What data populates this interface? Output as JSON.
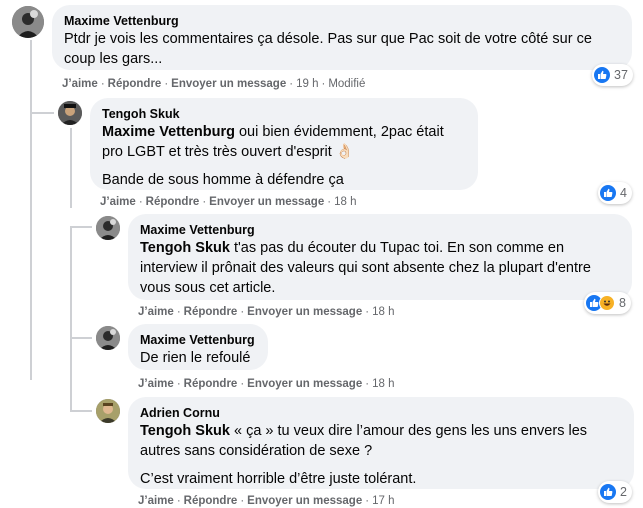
{
  "colors": {
    "bubble": "#f0f2f5",
    "like_blue": "#1877f2",
    "meta_gray": "#65676b",
    "thread_line": "#ced0d4"
  },
  "actions": {
    "like": "J’aime",
    "reply": "Répondre",
    "message": "Envoyer un message",
    "dot": "·"
  },
  "comments": [
    {
      "author": "Maxime Vettenburg",
      "avatar_icon": "user-avatar-icon",
      "text": "Ptdr je vois les commentaires ça désole. Pas sur que Pac soit de votre côté sur ce coup les gars...",
      "time": "19 h",
      "edited": "Modifié",
      "reactions": {
        "icons": [
          "like-icon"
        ],
        "count": "37"
      }
    },
    {
      "author": "Tengoh Skuk",
      "avatar_icon": "user-avatar-icon",
      "mention": "Maxime Vettenburg",
      "text": " oui bien évidemment, 2pac était pro LGBT et très très ouvert d'esprit 👌🏻",
      "text2": "Bande de sous homme à défendre ça",
      "time": "18 h",
      "reactions": {
        "icons": [
          "like-icon"
        ],
        "count": "4"
      }
    },
    {
      "author": "Maxime Vettenburg",
      "avatar_icon": "user-avatar-icon",
      "mention": "Tengoh Skuk",
      "text": " t'as pas du écouter du Tupac toi. En son comme en interview il prônait des valeurs qui sont absente chez la plupart d'entre vous sous cet article.",
      "time": "18 h",
      "reactions": {
        "icons": [
          "like-icon",
          "haha-icon"
        ],
        "count": "8"
      }
    },
    {
      "author": "Maxime Vettenburg",
      "avatar_icon": "user-avatar-icon",
      "text": "De rien le refoulé",
      "time": "18 h"
    },
    {
      "author": "Adrien Cornu",
      "avatar_icon": "user-avatar-icon",
      "mention": "Tengoh Skuk",
      "text": " « ça » tu veux dire l’amour des gens les uns envers les autres sans considération de sexe ?",
      "text2": "C’est vraiment horrible d’être juste tolérant.",
      "time": "17 h",
      "reactions": {
        "icons": [
          "like-icon"
        ],
        "count": "2"
      }
    }
  ]
}
